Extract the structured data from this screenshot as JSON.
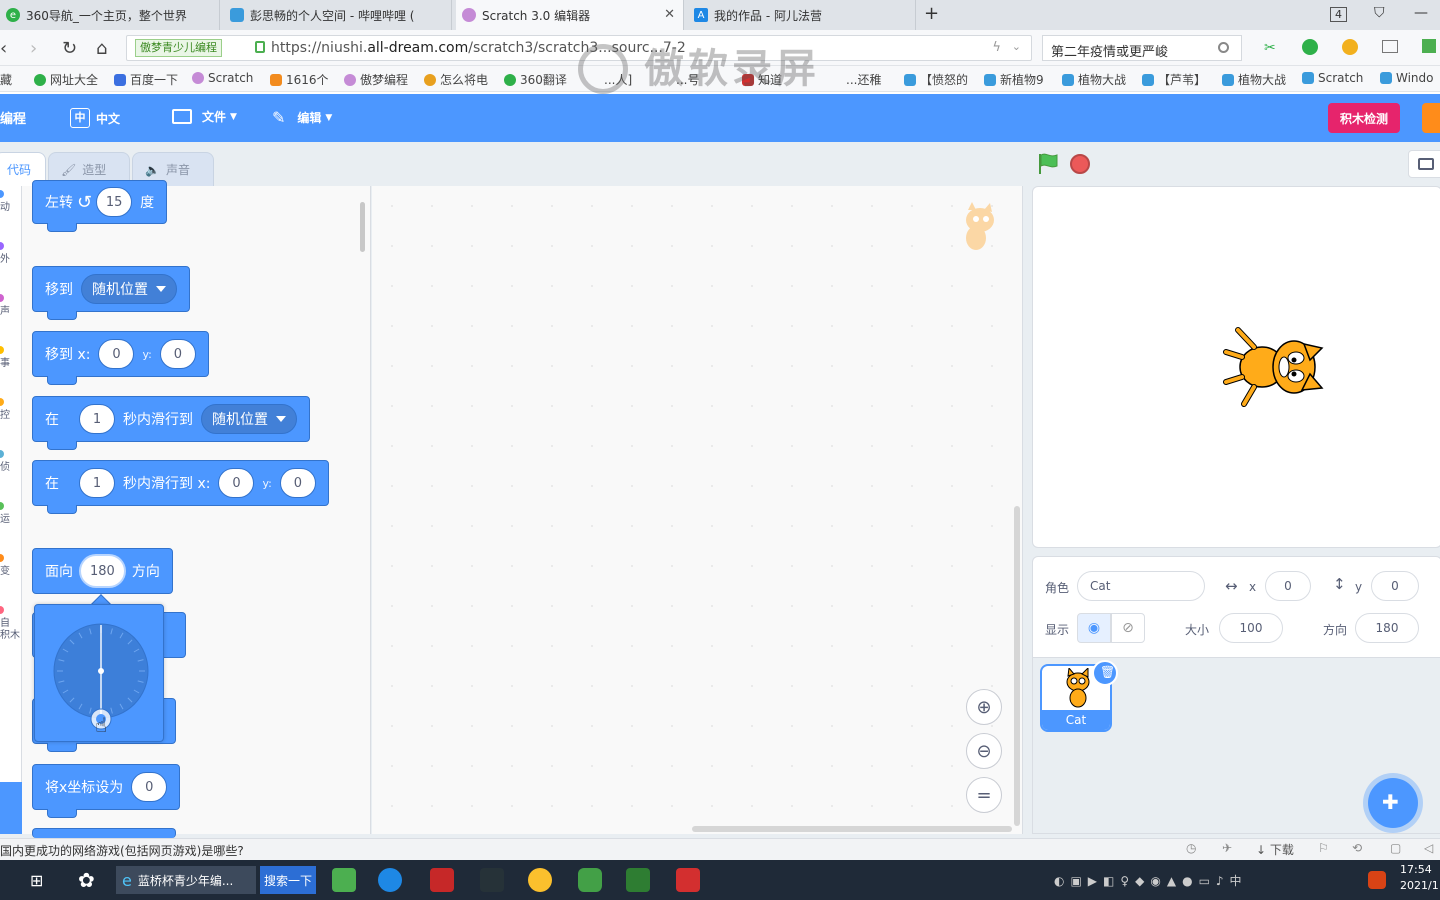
{
  "browser": {
    "tabs": [
      {
        "title": "360导航_一个主页，整个世界"
      },
      {
        "title": "彭思畅的个人空间 - 哔哩哔哩 ("
      },
      {
        "title": "Scratch 3.0 编辑器"
      },
      {
        "title": "我的作品 - 阿儿法营"
      }
    ],
    "tab_count_badge": "4",
    "url_badge": "傲梦青少儿编程",
    "url_prefix": "https://niushi.",
    "url_domain": "all-dream.com",
    "url_suffix": "/scratch3/scratch3...sourc...7-2",
    "search_text": "第二年疫情或更严峻",
    "bookmarks": [
      "藏",
      "网址大全",
      "百度一下",
      "Scratch",
      "1616个",
      "傲梦编程",
      "怎么将电",
      "360翻译",
      "...人]",
      "...号",
      "知道",
      "...还稚",
      "【愤怒的",
      "新植物9",
      "植物大战",
      "【芦苇】",
      "植物大战",
      "Scratch",
      "Windo"
    ]
  },
  "watermark": "傲软录屏",
  "menubar": {
    "logo": "编程",
    "language": "中文",
    "file": "文件",
    "edit": "编辑",
    "check_button": "积木检测"
  },
  "editor_tabs": {
    "code": "代码",
    "costume": "造型",
    "sound": "声音"
  },
  "category_strip": [
    "动",
    "外",
    "声",
    "事",
    "控",
    "侦",
    "运",
    "变",
    "自",
    "积木"
  ],
  "blocks": {
    "turn_left": {
      "label": "左转",
      "value": "15",
      "unit": "度"
    },
    "goto": {
      "label": "移到",
      "option": "随机位置"
    },
    "goto_xy": {
      "label": "移到 x:",
      "x": "0",
      "ylabel": "y:",
      "y": "0"
    },
    "glide": {
      "label_a": "在",
      "secs": "1",
      "label_b": "秒内滑行到",
      "option": "随机位置"
    },
    "glide_xy": {
      "label_a": "在",
      "secs": "1",
      "label_b": "秒内滑行到 x:",
      "x": "0",
      "ylabel": "y:",
      "y": "0"
    },
    "point_dir": {
      "label_a": "面向",
      "value": "180",
      "label_b": "方向"
    },
    "set_x": {
      "label": "将x坐标设为",
      "value": "0"
    }
  },
  "sprite_info": {
    "sprite_label": "角色",
    "sprite_name": "Cat",
    "x_label": "x",
    "x": "0",
    "y_label": "y",
    "y": "0",
    "show_label": "显示",
    "size_label": "大小",
    "size": "100",
    "direction_label": "方向",
    "direction": "180"
  },
  "sprite_list": [
    {
      "name": "Cat"
    }
  ],
  "colors": {
    "scratch_blue": "#4c97ff",
    "motion_border": "#3373cc",
    "check_pink": "#e6246c",
    "stop_red": "#ec5959",
    "flag_green": "#4cbf56"
  },
  "status": {
    "text": "国内更成功的网络游戏(包括网页游戏)是哪些?",
    "download": "下载"
  },
  "taskbar": {
    "app1": "蓝桥杯青少年编...",
    "search": "搜索一下",
    "time": "17:54",
    "date": "2021/1"
  }
}
